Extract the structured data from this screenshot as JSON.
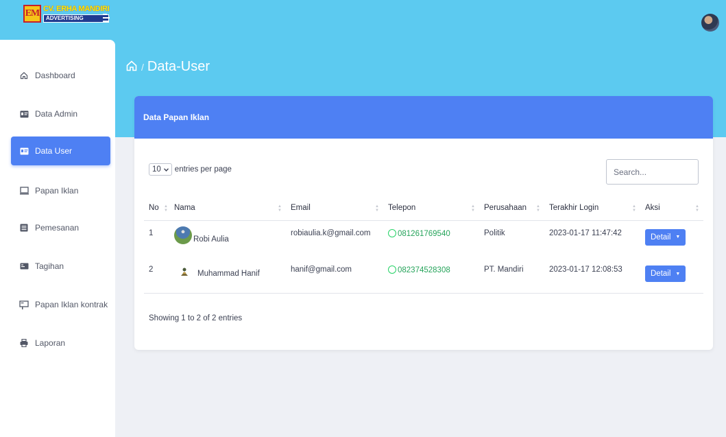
{
  "header": {
    "logo_line1": "CV. ERHA MANDIRI",
    "logo_line2": "ADVERTISING",
    "logo_mark": "EM"
  },
  "sidebar": {
    "items": [
      {
        "label": "Dashboard",
        "icon": "home-icon"
      },
      {
        "label": "Data Admin",
        "icon": "id-card-icon"
      },
      {
        "label": "Data User",
        "icon": "id-card-icon",
        "active": true
      },
      {
        "label": "Papan Iklan",
        "icon": "monitor-icon"
      },
      {
        "label": "Pemesanan",
        "icon": "list-icon"
      },
      {
        "label": "Tagihan",
        "icon": "card-icon"
      },
      {
        "label": "Papan Iklan kontrak",
        "icon": "billboard-icon"
      },
      {
        "label": "Laporan",
        "icon": "printer-icon"
      }
    ]
  },
  "page": {
    "title": "Data-User",
    "breadcrumb_sep": "/"
  },
  "card": {
    "title": "Data Papan Iklan",
    "entries_value": "10",
    "entries_label": "entries per page",
    "search_placeholder": "Search...",
    "columns": [
      "No",
      "Nama",
      "Email",
      "Telepon",
      "Perusahaan",
      "Terakhir Login",
      "Aksi"
    ],
    "rows": [
      {
        "no": "1",
        "nama": "Robi Aulia",
        "email": "robiaulia.k@gmail.com",
        "telepon": "081261769540",
        "perusahaan": "Politik",
        "login": "2023-01-17 11:47:42",
        "aksi": "Detail"
      },
      {
        "no": "2",
        "nama": "Muhammad Hanif",
        "email": "hanif@gmail.com",
        "telepon": "082374528308",
        "perusahaan": "PT. Mandiri",
        "login": "2023-01-17 12:08:53",
        "aksi": "Detail"
      }
    ],
    "showing": "Showing 1 to 2 of 2 entries"
  },
  "colors": {
    "header_bg": "#5ccaf0",
    "accent": "#4e80f3",
    "whatsapp": "#25d366"
  }
}
